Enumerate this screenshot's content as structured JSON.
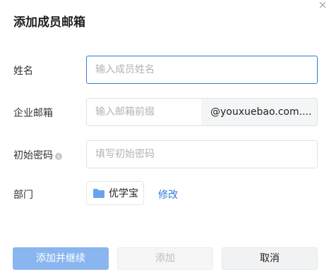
{
  "dialog": {
    "title": "添加成员邮箱",
    "close_icon": "close-icon"
  },
  "form": {
    "name": {
      "label": "姓名",
      "placeholder": "输入成员姓名",
      "value": ""
    },
    "email": {
      "label": "企业邮箱",
      "placeholder": "输入邮箱前缀",
      "value": "",
      "domain_suffix": "@youxuebao.com...."
    },
    "password": {
      "label": "初始密码",
      "placeholder": "填写初始密码",
      "value": "",
      "info_icon": "info-icon"
    },
    "department": {
      "label": "部门",
      "value": "优学宝",
      "icon": "folder-icon",
      "edit_label": "修改"
    }
  },
  "buttons": {
    "add_continue": "添加并继续",
    "add": "添加",
    "cancel": "取消"
  },
  "colors": {
    "accent": "#2f7ad8",
    "primary_button": "#8ab6f0",
    "folder": "#6aa3ec"
  }
}
